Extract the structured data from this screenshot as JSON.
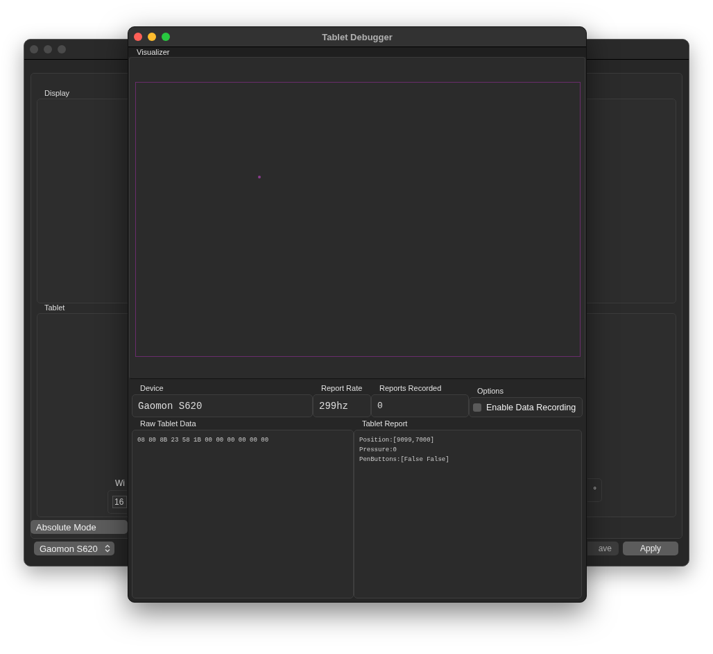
{
  "back_window": {
    "groups": [
      {
        "label": "Display"
      },
      {
        "label": "Tablet"
      }
    ],
    "width_label": "Wi",
    "width_value": "16",
    "angle_unit": "°",
    "mode_button": "Absolute Mode",
    "device_select": "Gaomon S620",
    "buttons": [
      "ave",
      "Apply"
    ]
  },
  "debugger": {
    "title": "Tablet Debugger",
    "visualizer": {
      "label": "Visualizer"
    },
    "device": {
      "label": "Device",
      "value": "Gaomon S620"
    },
    "report_rate": {
      "label": "Report Rate",
      "value": "299hz"
    },
    "reports_recorded": {
      "label": "Reports Recorded",
      "value": "0"
    },
    "options": {
      "label": "Options",
      "enable_recording": {
        "label": "Enable Data Recording",
        "checked": false
      }
    },
    "raw_data": {
      "label": "Raw Tablet Data",
      "lines": [
        "08 80 8B 23 58 1B 00 00 00 00 00 00"
      ]
    },
    "report": {
      "label": "Tablet Report",
      "lines": [
        "Position:[9099,7000]",
        "Pressure:0",
        "PenButtons:[False False]"
      ]
    }
  }
}
